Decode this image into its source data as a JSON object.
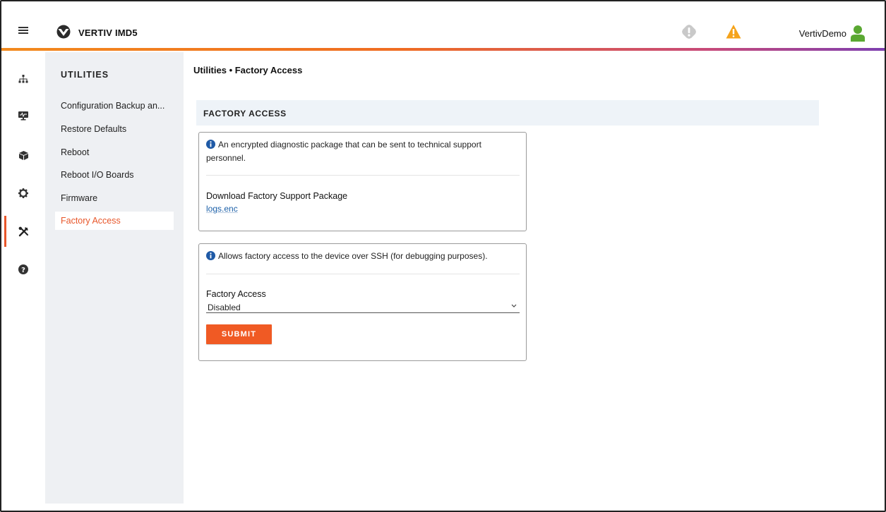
{
  "header": {
    "brand": "VERTIV IMD5",
    "username": "VertivDemo",
    "accent_gradient": [
      "#f28a1e",
      "#f06d22",
      "#c74a7a",
      "#7e3fb0"
    ],
    "icons": [
      "menu-icon",
      "vertiv-logo",
      "alarm-status-icon",
      "warning-icon",
      "user-icon"
    ]
  },
  "rail": {
    "items": [
      {
        "name": "topology-icon",
        "active": false
      },
      {
        "name": "monitor-icon",
        "active": false
      },
      {
        "name": "device-box-icon",
        "active": false
      },
      {
        "name": "settings-gear-icon",
        "active": false
      },
      {
        "name": "utilities-tools-icon",
        "active": true
      },
      {
        "name": "help-icon",
        "active": false
      }
    ]
  },
  "subnav": {
    "title": "UTILITIES",
    "items": [
      {
        "label": "Configuration Backup an...",
        "active": false
      },
      {
        "label": "Restore Defaults",
        "active": false
      },
      {
        "label": "Reboot",
        "active": false
      },
      {
        "label": "Reboot I/O Boards",
        "active": false
      },
      {
        "label": "Firmware",
        "active": false
      },
      {
        "label": "Factory Access",
        "active": true
      }
    ]
  },
  "main": {
    "breadcrumb": "Utilities • Factory Access",
    "section_title": "FACTORY ACCESS",
    "support_card": {
      "info": "An encrypted diagnostic package that can be sent to technical support personnel.",
      "label": "Download Factory Support Package",
      "link": "logs.enc"
    },
    "access_card": {
      "info": "Allows factory access to the device over SSH (for debugging purposes).",
      "label": "Factory Access",
      "select_value": "Disabled",
      "submit_label": "SUBMIT"
    }
  },
  "colors": {
    "accent": "#f05a24",
    "active_nav": "#e8562a",
    "link": "#1a5fa8",
    "info_icon": "#1f5aa6",
    "user_icon": "#5aa832",
    "warning_icon": "#f5a31a"
  }
}
